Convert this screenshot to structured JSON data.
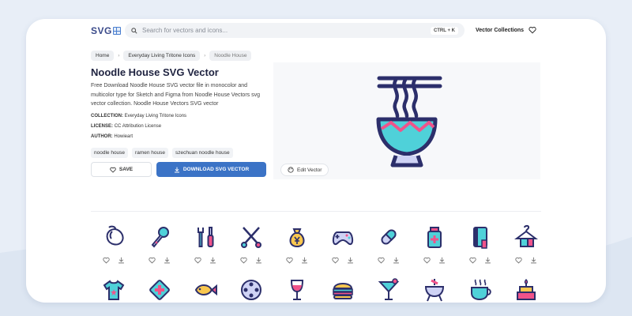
{
  "header": {
    "logo_text": "SVG",
    "search_placeholder": "Search for vectors and icons...",
    "shortcut": "CTRL + K",
    "nav_link": "Vector Collections"
  },
  "breadcrumb": [
    "Home",
    "Everyday Living Tritone Icons",
    "Noodle House"
  ],
  "detail": {
    "title": "Noodle House SVG Vector",
    "description": "Free Download Noodle House SVG vector file in monocolor and multicolor type for Sketch and Figma from Noodle House Vectors svg vector collection. Noodle House Vectors SVG vector",
    "collection_label": "COLLECTION:",
    "collection_value": "Everyday Living Tritone Icons",
    "license_label": "LICENSE:",
    "license_value": "CC Attribution License",
    "author_label": "AUTHOR:",
    "author_value": "Howieart",
    "tags": [
      "noodle house",
      "ramen house",
      "szechuan noodle house"
    ],
    "save_label": "SAVE",
    "download_label": "DOWNLOAD SVG VECTOR",
    "edit_label": "Edit Vector"
  },
  "icons_row1": [
    "mouse-icon",
    "microphone-icon",
    "tools-icon",
    "scissors-icon",
    "money-bag-icon",
    "gamepad-icon",
    "pill-icon",
    "medicine-bottle-icon",
    "book-icon",
    "clothes-hanger-icon"
  ],
  "icons_row2": [
    "tshirt-icon",
    "medical-sign-icon",
    "fish-icon",
    "film-reel-icon",
    "wine-glass-icon",
    "burger-icon",
    "cocktail-icon",
    "barbecue-icon",
    "coffee-cup-icon",
    "cake-icon"
  ],
  "colors": {
    "accent": "#3b73c6",
    "icon_outline": "#2c2f6b",
    "icon_teal": "#4fd1d9",
    "icon_pink": "#f0538a",
    "icon_yellow": "#f9c74f",
    "icon_lavender": "#cfd3f5"
  }
}
